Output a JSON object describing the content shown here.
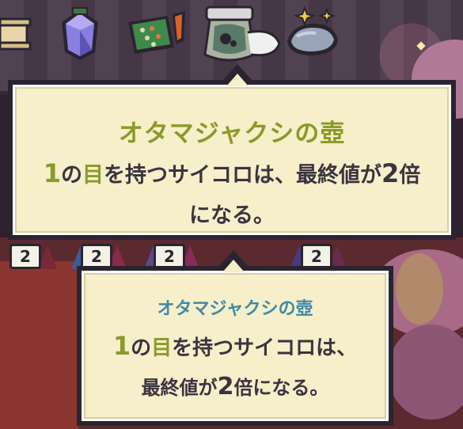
{
  "relics": [
    {
      "name": "scroll"
    },
    {
      "name": "crystal-gem"
    },
    {
      "name": "treasure-map"
    },
    {
      "name": "tadpole-jar"
    },
    {
      "name": "sparkling-rocks"
    }
  ],
  "tooltip_top": {
    "title": "オタマジャクシの壺",
    "line1_num": "1",
    "line1_a": "の",
    "line1_word": "目",
    "line1_b": "を持つサイコロは、最終値が",
    "line1_num2": "2",
    "line1_c": "倍",
    "line2": "になる。"
  },
  "tooltip_bottom": {
    "title": "オタマジャクシの壺",
    "line1_num": "1",
    "line1_a": "の",
    "line1_word": "目",
    "line1_b": "を持つサイコロは、",
    "line2_a": "最終値が",
    "line2_num": "2",
    "line2_b": "倍になる。"
  },
  "dice": [
    {
      "value": "2"
    },
    {
      "value": "2"
    },
    {
      "value": "2"
    },
    {
      "value": "2"
    }
  ],
  "colors": {
    "tooltip_bg": "#f6efc9",
    "border": "#2a2430",
    "title_green": "#8a9a2a",
    "title_blue": "#3f8aa8",
    "text": "#3b3340"
  }
}
